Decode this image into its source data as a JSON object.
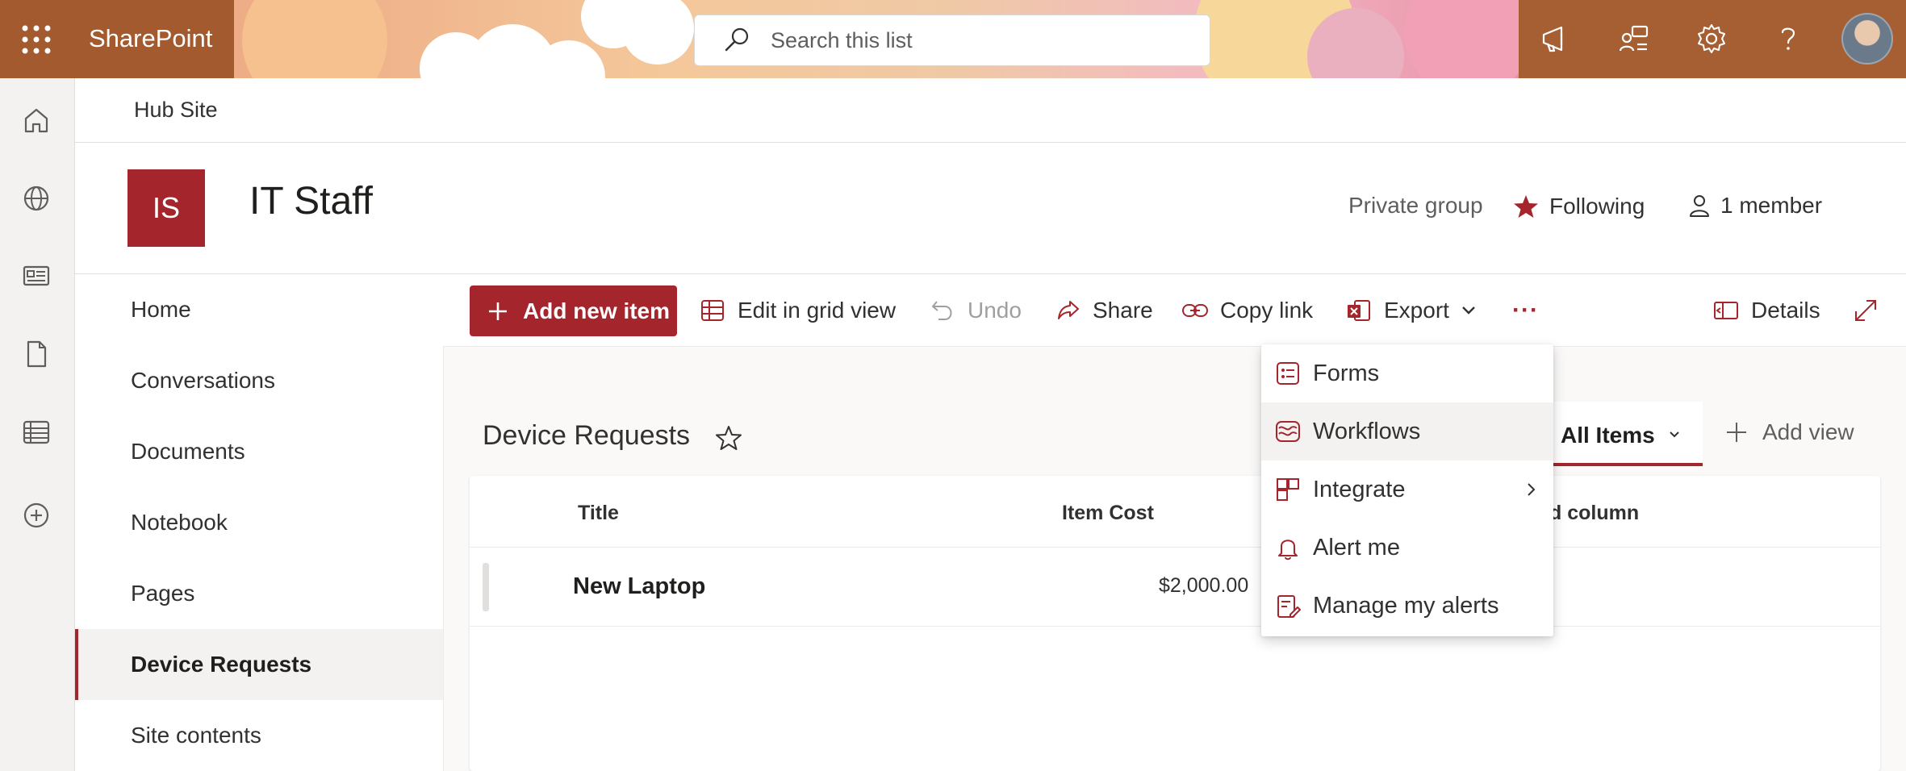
{
  "suite_bar": {
    "brand": "SharePoint",
    "search_placeholder": "Search this list"
  },
  "hub": {
    "title": "Hub Site"
  },
  "site": {
    "logo_initials": "IS",
    "title": "IT Staff",
    "privacy": "Private group",
    "following": "Following",
    "members": "1 member"
  },
  "quick_launch": {
    "items": [
      "Home",
      "Conversations",
      "Documents",
      "Notebook",
      "Pages",
      "Device Requests",
      "Site contents"
    ],
    "selected": "Device Requests"
  },
  "command_bar": {
    "add_new_item": "Add new item",
    "edit_grid": "Edit in grid view",
    "undo": "Undo",
    "share": "Share",
    "copy_link": "Copy link",
    "export": "Export",
    "more": "···",
    "details": "Details"
  },
  "list": {
    "title": "Device Requests",
    "view_name": "All Items",
    "add_view": "Add view",
    "columns": [
      "Title",
      "Item Cost",
      "d column"
    ],
    "rows": [
      {
        "title": "New Laptop",
        "item_cost": "$2,000.00"
      }
    ]
  },
  "dropdown_menu": {
    "items": [
      "Forms",
      "Workflows",
      "Integrate",
      "Alert me",
      "Manage my alerts"
    ],
    "hovered": "Workflows"
  },
  "colors": {
    "accent": "#a4262c",
    "suitebar_left": "#a35a2f",
    "suitebar_right": "#a65f33"
  }
}
